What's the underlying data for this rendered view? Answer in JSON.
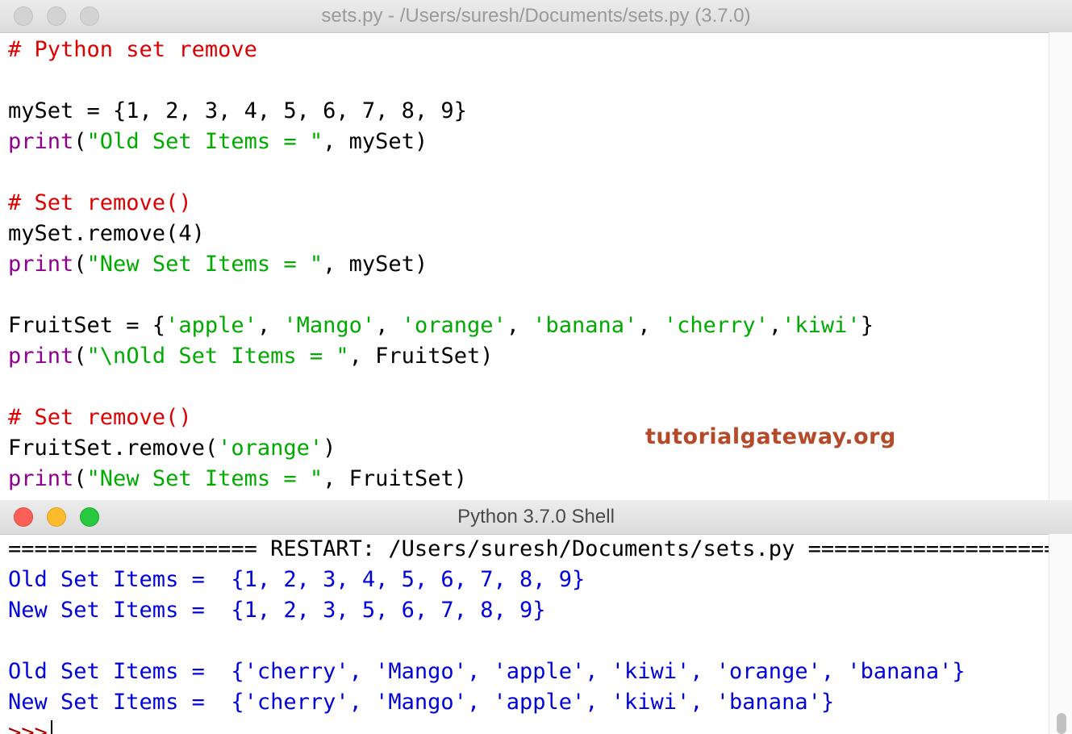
{
  "editor": {
    "title": "sets.py - /Users/suresh/Documents/sets.py (3.7.0)",
    "lines": [
      [
        {
          "t": "# Python set remove",
          "c": "cm"
        }
      ],
      [],
      [
        {
          "t": "mySet = {1, 2, 3, 4, 5, 6, 7, 8, 9}",
          "c": ""
        }
      ],
      [
        {
          "t": "print",
          "c": "kw"
        },
        {
          "t": "(",
          "c": ""
        },
        {
          "t": "\"Old Set Items = \"",
          "c": "st"
        },
        {
          "t": ", mySet)",
          "c": ""
        }
      ],
      [],
      [
        {
          "t": "# Set remove()",
          "c": "cm"
        }
      ],
      [
        {
          "t": "mySet.remove(4)",
          "c": ""
        }
      ],
      [
        {
          "t": "print",
          "c": "kw"
        },
        {
          "t": "(",
          "c": ""
        },
        {
          "t": "\"New Set Items = \"",
          "c": "st"
        },
        {
          "t": ", mySet)",
          "c": ""
        }
      ],
      [],
      [
        {
          "t": "FruitSet = {",
          "c": ""
        },
        {
          "t": "'apple'",
          "c": "st"
        },
        {
          "t": ", ",
          "c": ""
        },
        {
          "t": "'Mango'",
          "c": "st"
        },
        {
          "t": ", ",
          "c": ""
        },
        {
          "t": "'orange'",
          "c": "st"
        },
        {
          "t": ", ",
          "c": ""
        },
        {
          "t": "'banana'",
          "c": "st"
        },
        {
          "t": ", ",
          "c": ""
        },
        {
          "t": "'cherry'",
          "c": "st"
        },
        {
          "t": ",",
          "c": ""
        },
        {
          "t": "'kiwi'",
          "c": "st"
        },
        {
          "t": "}",
          "c": ""
        }
      ],
      [
        {
          "t": "print",
          "c": "kw"
        },
        {
          "t": "(",
          "c": ""
        },
        {
          "t": "\"\\nOld Set Items = \"",
          "c": "st"
        },
        {
          "t": ", FruitSet)",
          "c": ""
        }
      ],
      [],
      [
        {
          "t": "# Set remove()",
          "c": "cm"
        }
      ],
      [
        {
          "t": "FruitSet.remove(",
          "c": ""
        },
        {
          "t": "'orange'",
          "c": "st"
        },
        {
          "t": ")",
          "c": ""
        }
      ],
      [
        {
          "t": "print",
          "c": "kw"
        },
        {
          "t": "(",
          "c": ""
        },
        {
          "t": "\"New Set Items = \"",
          "c": "st"
        },
        {
          "t": ", FruitSet)",
          "c": ""
        }
      ]
    ]
  },
  "watermark": "tutorialgateway.org",
  "shell": {
    "title": "Python 3.7.0 Shell",
    "lines": [
      [
        {
          "t": "=================== RESTART: /Users/suresh/Documents/sets.py ===================",
          "c": ""
        }
      ],
      [
        {
          "t": "Old Set Items =  {1, 2, 3, 4, 5, 6, 7, 8, 9}",
          "c": "out"
        }
      ],
      [
        {
          "t": "New Set Items =  {1, 2, 3, 5, 6, 7, 8, 9}",
          "c": "out"
        }
      ],
      [],
      [
        {
          "t": "Old Set Items =  {'cherry', 'Mango', 'apple', 'kiwi', 'orange', 'banana'}",
          "c": "out"
        }
      ],
      [
        {
          "t": "New Set Items =  {'cherry', 'Mango', 'apple', 'kiwi', 'banana'}",
          "c": "out"
        }
      ]
    ],
    "prompt": ">>>"
  },
  "colors": {
    "comment": "#dd0000",
    "keyword": "#900090",
    "string": "#00aa00",
    "output": "#0000dd",
    "prompt": "#aa0000"
  }
}
